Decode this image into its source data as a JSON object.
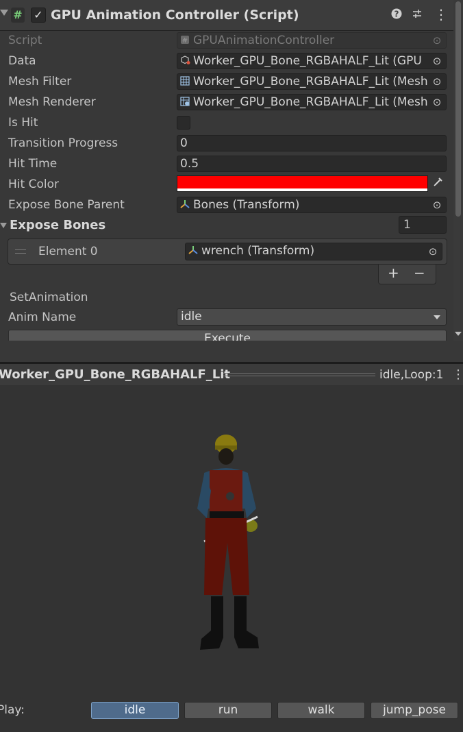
{
  "header": {
    "title": "GPU Animation Controller (Script)",
    "icon": "script-icon",
    "enabled": true
  },
  "fields": {
    "script": {
      "label": "Script",
      "value": "GPUAnimationController"
    },
    "data": {
      "label": "Data",
      "value": "Worker_GPU_Bone_RGBAHALF_Lit (GPU"
    },
    "mesh_filter": {
      "label": "Mesh Filter",
      "value": "Worker_GPU_Bone_RGBAHALF_Lit (Mesh"
    },
    "mesh_renderer": {
      "label": "Mesh Renderer",
      "value": "Worker_GPU_Bone_RGBAHALF_Lit (Mesh"
    },
    "is_hit": {
      "label": "Is Hit",
      "checked": false
    },
    "transition_progress": {
      "label": "Transition Progress",
      "value": "0"
    },
    "hit_time": {
      "label": "Hit Time",
      "value": "0.5"
    },
    "hit_color": {
      "label": "Hit Color",
      "color": "#ff0000"
    },
    "expose_bone_parent": {
      "label": "Expose Bone Parent",
      "value": "Bones (Transform)"
    }
  },
  "expose_bones": {
    "title": "Expose Bones",
    "count": "1",
    "elements": [
      {
        "label": "Element 0",
        "value": "wrench (Transform)"
      }
    ],
    "add_label": "+",
    "remove_label": "−"
  },
  "set_animation": {
    "title": "SetAnimation",
    "anim_name_label": "Anim Name",
    "anim_name_value": "idle",
    "execute_label": "Execute"
  },
  "preview": {
    "title": "Worker_GPU_Bone_RGBAHALF_Lit",
    "status": "idle,Loop:1",
    "play_label": "Play:",
    "buttons": [
      "idle",
      "run",
      "walk",
      "jump_pose"
    ],
    "active_button": "idle"
  },
  "colors": {
    "accent": "#4f6b8b",
    "hit_color": "#ff0000",
    "background": "#383838"
  }
}
